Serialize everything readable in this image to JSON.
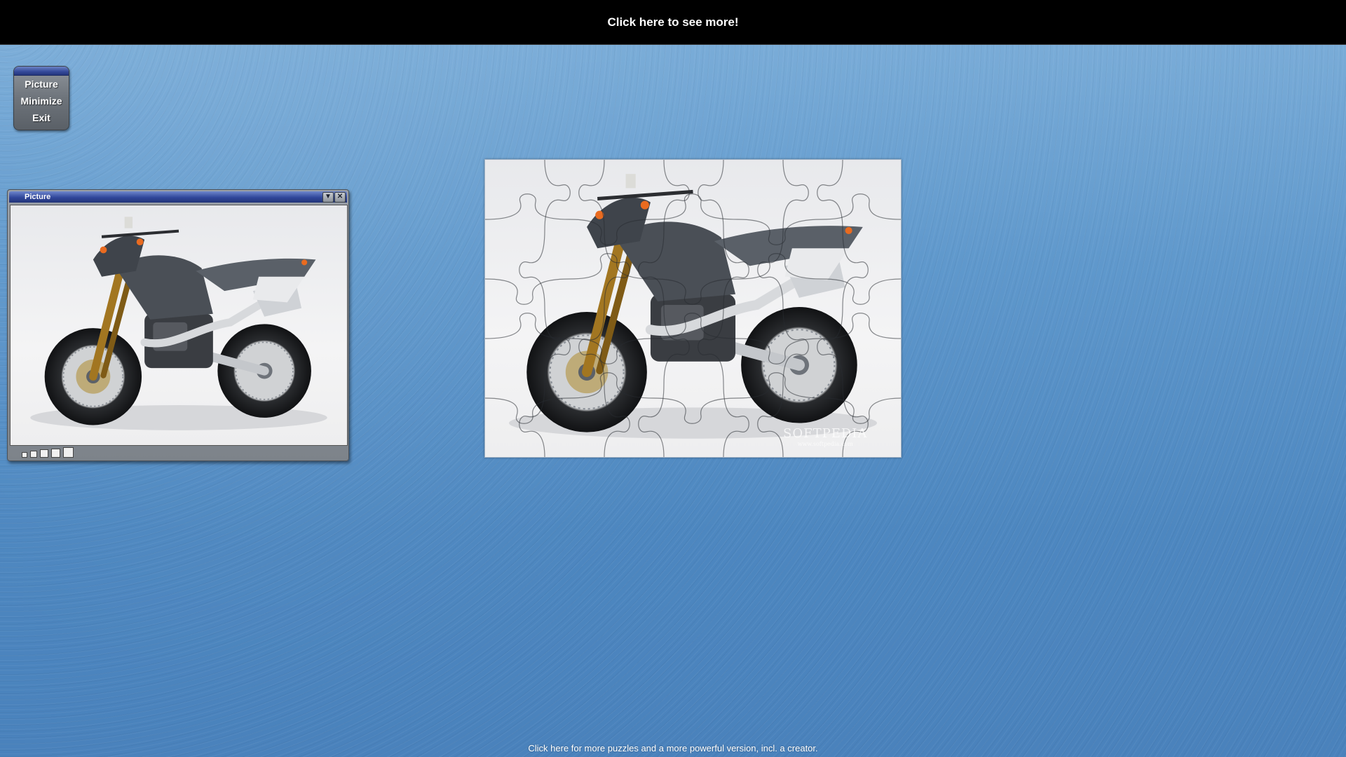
{
  "top_bar": {
    "link_text": "Click here to see more!"
  },
  "side_menu": {
    "items": [
      {
        "label": "Picture"
      },
      {
        "label": "Minimize"
      },
      {
        "label": "Exit"
      }
    ]
  },
  "picture_window": {
    "title": "Picture",
    "minimize_glyph": "▼",
    "close_glyph": "✕",
    "size_options": 5
  },
  "puzzle": {
    "subject": "motorcycle",
    "watermark": "SOFTPEDIA",
    "watermark_url": "www.softpedia.com"
  },
  "bottom_link": {
    "text": "Click here for more puzzles and a more powerful version, incl. a creator."
  },
  "colors": {
    "background": "#5f98cc",
    "title_bar": "#30469a",
    "banner": "#000000"
  }
}
